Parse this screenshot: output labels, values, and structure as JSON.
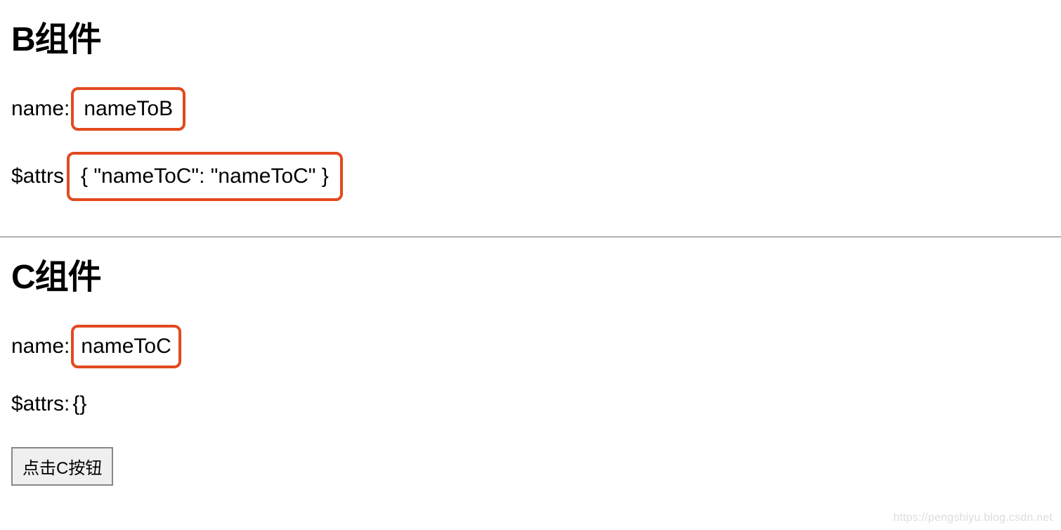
{
  "componentB": {
    "title": "B组件",
    "nameLabel": "name:",
    "nameValue": " nameToB",
    "attrsLabel": "$attrs",
    "attrsValue": " { \"nameToC\": \"nameToC\" }"
  },
  "componentC": {
    "title": "C组件",
    "nameLabel": "name: ",
    "nameValue": "nameToC",
    "attrsLabel": "$attrs: ",
    "attrsValue": "{}",
    "buttonLabel": "点击C按钮"
  },
  "watermark": "https://pengshiyu.blog.csdn.net"
}
